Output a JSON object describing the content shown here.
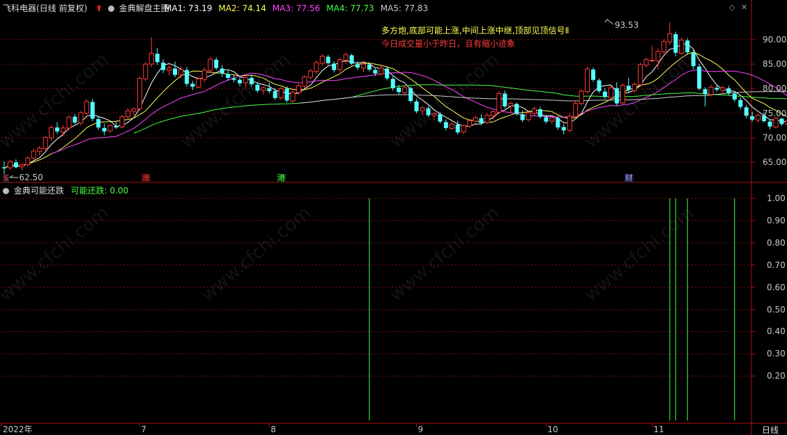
{
  "header": {
    "stock_title": "飞科电器(日线 前复权)",
    "indicator_name": "金典解盘主图",
    "ma": [
      {
        "label": "MA1:",
        "value": "73.19",
        "color": "#ffffff"
      },
      {
        "label": "MA2:",
        "value": "74.14",
        "color": "#ffff55"
      },
      {
        "label": "MA3:",
        "value": "77.56",
        "color": "#ff44ff"
      },
      {
        "label": "MA4:",
        "value": "77.73",
        "color": "#44ff44"
      },
      {
        "label": "MA5:",
        "value": "77.83",
        "color": "#cccccc"
      }
    ]
  },
  "annotations": {
    "line1": "多方炮,底部可能上涨,中间上涨中继,顶部见顶信号Ⅱ",
    "line2": "今日成交量小于昨日，且有缩小迹象",
    "high_label": "93.53",
    "low_label": "62.50"
  },
  "markers": {
    "zhang": "涨",
    "gang": "港",
    "cai": "财",
    "dollar": "$"
  },
  "sub_header": {
    "indicator_name": "金典可能还跌",
    "series_label": "可能还跌:",
    "series_value": "0.00"
  },
  "period_label": "日线",
  "watermark": "www.cfchi.com",
  "colors": {
    "background": "#000000",
    "up_candle": "#ff3b3b",
    "down_candle": "#54ffff",
    "ma1": "#ffffff",
    "ma2": "#ffff55",
    "ma3": "#ff44ff",
    "ma4": "#44ff44",
    "ma5": "#cccccc",
    "signal": "#44ff44",
    "grid": "#7a1010",
    "axis": "#b01010"
  },
  "chart_data": [
    {
      "type": "candlestick",
      "title": "金典解盘主图",
      "y_ticks": [
        65,
        70,
        75,
        80,
        85,
        90
      ],
      "y_tick_labels": [
        "65.00",
        "70.00",
        "75.00",
        "80.00",
        "85.00",
        "90.00"
      ],
      "ylim": [
        61.5,
        95.5
      ],
      "x_tick_labels": [
        "2022年",
        "7",
        "8",
        "9",
        "10",
        "11"
      ],
      "x_tick_index": [
        0,
        23,
        45,
        70,
        92,
        110
      ],
      "high_marker": {
        "index": 102,
        "value": 93.53
      },
      "low_marker": {
        "index": 1,
        "value": 62.5
      },
      "markers": [
        {
          "index": 24,
          "text": "涨"
        },
        {
          "index": 47,
          "text": "港"
        },
        {
          "index": 106,
          "text": "财"
        }
      ],
      "candles": [
        [
          64,
          65.2,
          62.5,
          63.8
        ],
        [
          63.9,
          65.5,
          63.5,
          65.1
        ],
        [
          65,
          65.6,
          63.8,
          64.0
        ],
        [
          64.1,
          64.8,
          63.4,
          64.5
        ],
        [
          64.5,
          66.2,
          64.2,
          65.9
        ],
        [
          65.9,
          67.8,
          65.5,
          67.3
        ],
        [
          67.2,
          68.3,
          66.5,
          67.9
        ],
        [
          67.8,
          70.5,
          67.2,
          70.1
        ],
        [
          70,
          72.5,
          69.4,
          72.1
        ],
        [
          72.1,
          73.2,
          70.8,
          71.3
        ],
        [
          71.2,
          72.5,
          70.3,
          72.0
        ],
        [
          72,
          74.5,
          71.5,
          74.2
        ],
        [
          74.3,
          74.8,
          72.8,
          73.1
        ],
        [
          73,
          75.5,
          72.5,
          75.1
        ],
        [
          75,
          77.8,
          74.6,
          77.4
        ],
        [
          77.3,
          77.9,
          73.4,
          73.9
        ],
        [
          73.8,
          74.5,
          71.6,
          72.1
        ],
        [
          72,
          72.9,
          70.5,
          71.3
        ],
        [
          71.4,
          72.8,
          71,
          72.5
        ],
        [
          72.4,
          73.3,
          71.8,
          72.1
        ],
        [
          72.2,
          74.6,
          71.9,
          74.3
        ],
        [
          74.3,
          76,
          73.8,
          75.5
        ],
        [
          75.4,
          76.2,
          74.5,
          75.9
        ],
        [
          75.9,
          82.5,
          75.5,
          82.1
        ],
        [
          82,
          85.5,
          81.5,
          85
        ],
        [
          85,
          90.5,
          84.4,
          87.2
        ],
        [
          87.1,
          88.3,
          84.8,
          85.4
        ],
        [
          85.3,
          86,
          83.2,
          83.8
        ],
        [
          83.7,
          84.8,
          82.7,
          84.2
        ],
        [
          84.1,
          85.5,
          82.3,
          82.8
        ],
        [
          82.8,
          84.5,
          82.1,
          83.9
        ],
        [
          83.8,
          84.4,
          80.4,
          81.0
        ],
        [
          81,
          81.6,
          79.7,
          80.4
        ],
        [
          80.3,
          82.5,
          80.1,
          82.0
        ],
        [
          81.9,
          84.3,
          81.3,
          83.8
        ],
        [
          83.7,
          86.5,
          83.2,
          86.0
        ],
        [
          85.9,
          86.4,
          83.8,
          84.2
        ],
        [
          84.1,
          84.8,
          82.4,
          83.1
        ],
        [
          83,
          83.7,
          81.6,
          82.2
        ],
        [
          82.1,
          82.8,
          81.3,
          81.8
        ],
        [
          81.8,
          82.5,
          80.5,
          81.1
        ],
        [
          81.2,
          82.5,
          80.2,
          82.3
        ],
        [
          82.2,
          82.9,
          80.4,
          80.9
        ],
        [
          80.8,
          81.4,
          79.2,
          79.6
        ],
        [
          79.7,
          80.5,
          78.8,
          80.2
        ],
        [
          80.1,
          81.2,
          79,
          79.5
        ],
        [
          79.5,
          80.2,
          77.7,
          78.1
        ],
        [
          78.1,
          80.3,
          77.7,
          80.0
        ],
        [
          80,
          80.5,
          77.2,
          77.6
        ],
        [
          77.5,
          79.7,
          77.1,
          79.3
        ],
        [
          79.2,
          81,
          78.8,
          80.6
        ],
        [
          80.5,
          82.8,
          80.1,
          82.4
        ],
        [
          82.3,
          84.1,
          81.9,
          83.6
        ],
        [
          83.5,
          85.8,
          83,
          85.3
        ],
        [
          85.2,
          87.1,
          84.6,
          86.6
        ],
        [
          86.5,
          86.9,
          84.8,
          85.2
        ],
        [
          85.1,
          85.6,
          83.3,
          83.8
        ],
        [
          83.9,
          86.3,
          83.4,
          85.9
        ],
        [
          85.8,
          87.4,
          85.1,
          86.9
        ],
        [
          86.8,
          87.1,
          84.8,
          85.1
        ],
        [
          85,
          85.6,
          83.8,
          84.3
        ],
        [
          84.2,
          85.4,
          83.4,
          85
        ],
        [
          84.9,
          85.4,
          83.5,
          83.9
        ],
        [
          83.8,
          84.2,
          82.6,
          83.1
        ],
        [
          83,
          84.6,
          82.6,
          84.2
        ],
        [
          84.1,
          84.6,
          81.7,
          82.1
        ],
        [
          82,
          82.5,
          79.6,
          80.1
        ],
        [
          80.2,
          80.8,
          78.8,
          79.3
        ],
        [
          79.2,
          80.5,
          78.8,
          80.2
        ],
        [
          80.1,
          80.5,
          77.1,
          77.5
        ],
        [
          77.4,
          77.9,
          75,
          75.4
        ],
        [
          75.5,
          76.5,
          74.7,
          76.1
        ],
        [
          76,
          76.5,
          74.2,
          74.6
        ],
        [
          74.5,
          75.3,
          73.6,
          74.9
        ],
        [
          74.8,
          75.3,
          72.9,
          73.3
        ],
        [
          73.2,
          73.7,
          71.5,
          72
        ],
        [
          71.9,
          73.3,
          71.7,
          72.8
        ],
        [
          72.7,
          73.5,
          70.7,
          71.1
        ],
        [
          71.2,
          72.7,
          70.8,
          72.5
        ],
        [
          72.4,
          73.8,
          72,
          73.5
        ],
        [
          73.4,
          74.5,
          72.9,
          74.1
        ],
        [
          74,
          74.8,
          72.6,
          73
        ],
        [
          73.1,
          75,
          72.8,
          74.6
        ],
        [
          74.5,
          75.6,
          73.7,
          75.3
        ],
        [
          75.2,
          79.5,
          74.8,
          79
        ],
        [
          79,
          79.6,
          76,
          76.4
        ],
        [
          76.5,
          77.4,
          75.1,
          77.0
        ],
        [
          76.9,
          77.2,
          74.5,
          74.9
        ],
        [
          74.8,
          75.6,
          73.2,
          73.6
        ],
        [
          73.7,
          75.4,
          73.3,
          75.1
        ],
        [
          75,
          76.4,
          74.6,
          75.9
        ],
        [
          75.8,
          76.3,
          73.9,
          74.3
        ],
        [
          74.2,
          74.7,
          72.9,
          73.3
        ],
        [
          73.4,
          74.5,
          72.8,
          74.1
        ],
        [
          74,
          74.4,
          71.6,
          72.1
        ],
        [
          72.2,
          72.8,
          70.7,
          71.5
        ],
        [
          71.5,
          74.9,
          71.1,
          74.4
        ],
        [
          74.3,
          77.4,
          73.9,
          77
        ],
        [
          77,
          79.9,
          76.6,
          79.5
        ],
        [
          79.4,
          84.5,
          79,
          84
        ],
        [
          83.9,
          84.3,
          81.4,
          81.8
        ],
        [
          81.7,
          82.1,
          79.1,
          79.5
        ],
        [
          79.4,
          80.1,
          77.9,
          78.3
        ],
        [
          78.2,
          80.6,
          77.8,
          80.2
        ],
        [
          80.1,
          81.3,
          76.5,
          77
        ],
        [
          77.1,
          81.1,
          76.7,
          80.7
        ],
        [
          80.6,
          82.2,
          79.2,
          79.7
        ],
        [
          79.6,
          81.3,
          79.1,
          80.9
        ],
        [
          80.8,
          85.3,
          80.3,
          84.9
        ],
        [
          84.8,
          86.4,
          84.3,
          85.9
        ],
        [
          85.8,
          88.7,
          85.4,
          85.8
        ],
        [
          85.7,
          88.2,
          83.9,
          87.6
        ],
        [
          87.5,
          90.1,
          87,
          89.6
        ],
        [
          89.5,
          93.53,
          88.9,
          91.2
        ],
        [
          91.1,
          91.6,
          86.6,
          87.3
        ],
        [
          87.2,
          90.5,
          86.8,
          89.9
        ],
        [
          89.8,
          90.3,
          86.9,
          87.4
        ],
        [
          87.3,
          87.9,
          84,
          84.6
        ],
        [
          84.5,
          85.1,
          79.6,
          80.0
        ],
        [
          79.9,
          80.3,
          76.4,
          78.9
        ],
        [
          78.8,
          80.8,
          78.4,
          80.3
        ],
        [
          80.2,
          80.7,
          79.4,
          79.8
        ],
        [
          79.7,
          80.6,
          79.1,
          80.2
        ],
        [
          80.1,
          80.6,
          78.6,
          79.1
        ],
        [
          79,
          79.5,
          77.3,
          77.8
        ],
        [
          77.7,
          78.2,
          75.8,
          76.3
        ],
        [
          76.2,
          76.7,
          74,
          74.5
        ],
        [
          74.4,
          75.3,
          73.3,
          73.7
        ],
        [
          73.6,
          75,
          73.1,
          74.6
        ],
        [
          74.5,
          75.2,
          73.1,
          73.4
        ],
        [
          73.3,
          73.8,
          71.7,
          72.3
        ],
        [
          72.2,
          74.3,
          71.9,
          74
        ],
        [
          73.9,
          74.1,
          72.4,
          72.8
        ],
        [
          72.7,
          74,
          72.3,
          73.5
        ],
        [
          73.4,
          73.9,
          71.9,
          72.3
        ]
      ]
    },
    {
      "type": "bar",
      "title": "金典可能还跌",
      "series_name": "可能还跌",
      "last_value": 0.0,
      "ylim": [
        0,
        1.0
      ],
      "y_ticks": [
        0.2,
        0.3,
        0.4,
        0.5,
        0.6,
        0.7,
        0.8,
        0.9,
        1.0
      ],
      "y_tick_labels": [
        "0.20",
        "0.30",
        "0.40",
        "0.50",
        "0.60",
        "0.70",
        "0.80",
        "0.90",
        "1.00"
      ],
      "signal_indices": [
        62,
        113,
        114,
        116,
        124
      ],
      "signal_value": 1.0
    }
  ]
}
